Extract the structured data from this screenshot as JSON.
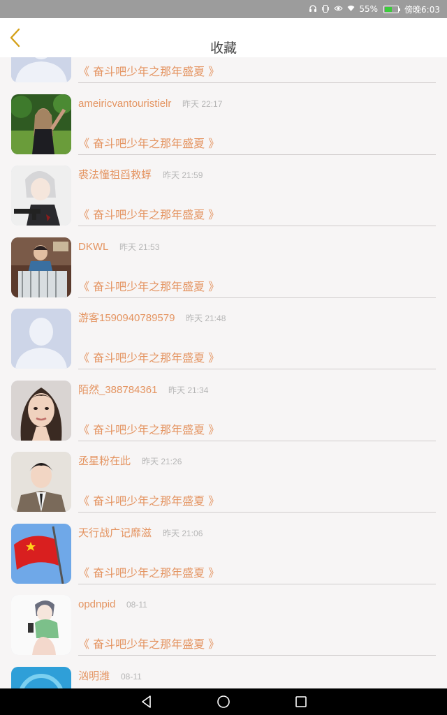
{
  "status_bar": {
    "battery": "55%",
    "battery_level": 0.55,
    "time": "傍晚6:03",
    "icons": [
      "headphones-icon",
      "vibrate-icon",
      "eye-icon",
      "wifi-icon",
      "battery-icon"
    ],
    "battery_color": "#3ccb3c"
  },
  "header": {
    "title": "收藏",
    "back_icon": "chevron-left-icon",
    "back_color": "#d4a017"
  },
  "colors": {
    "accent": "#e49461",
    "time_text": "#b6b6b6"
  },
  "items": [
    {
      "username": "",
      "time": "",
      "work": "《 奋斗吧少年之那年盛夏 》",
      "avatar": "default-avatar"
    },
    {
      "username": "ameiricvantouristielr",
      "time": "昨天 22:17",
      "work": "《 奋斗吧少年之那年盛夏 》",
      "avatar": "photo-girl-park"
    },
    {
      "username": "裘法憧祖舀救蜉",
      "time": "昨天 21:59",
      "work": "《 奋斗吧少年之那年盛夏 》",
      "avatar": "anime-gun"
    },
    {
      "username": "DKWL",
      "time": "昨天 21:53",
      "work": "《 奋斗吧少年之那年盛夏 》",
      "avatar": "photo-boy-room"
    },
    {
      "username": "游客1590940789579",
      "time": "昨天 21:48",
      "work": "《 奋斗吧少年之那年盛夏 》",
      "avatar": "default-avatar"
    },
    {
      "username": "陌然_388784361",
      "time": "昨天 21:34",
      "work": "《 奋斗吧少年之那年盛夏 》",
      "avatar": "photo-woman"
    },
    {
      "username": "丞星粉在此",
      "time": "昨天 21:26",
      "work": "《 奋斗吧少年之那年盛夏 》",
      "avatar": "photo-man-suit"
    },
    {
      "username": "天行战广记靡滋",
      "time": "昨天 21:06",
      "work": "《 奋斗吧少年之那年盛夏 》",
      "avatar": "flag"
    },
    {
      "username": "opdnpid",
      "time": "08-11",
      "work": "《 奋斗吧少年之那年盛夏 》",
      "avatar": "anime-sketch"
    },
    {
      "username": "汹明潍",
      "time": "08-11",
      "work": "",
      "avatar": "blue-circle"
    }
  ],
  "nav": {
    "back": "nav-back-icon",
    "home": "nav-home-icon",
    "recents": "nav-recents-icon"
  }
}
